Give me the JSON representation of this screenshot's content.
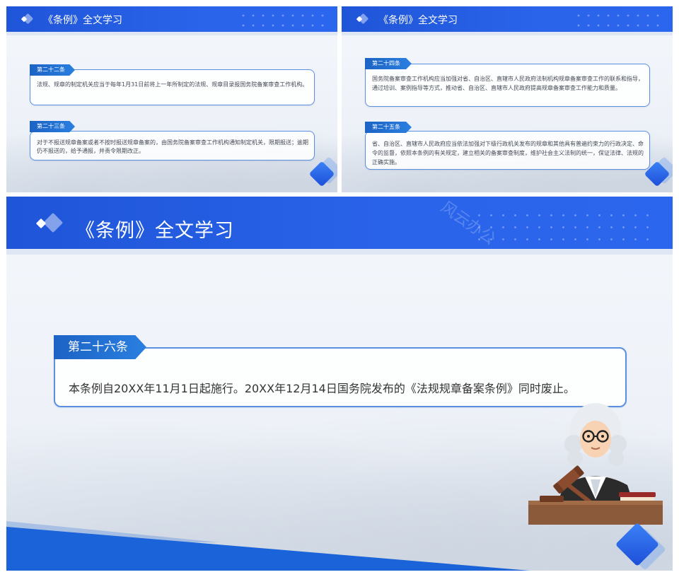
{
  "slides": [
    {
      "title": "《条例》全文学习",
      "articles": [
        {
          "tag": "第二十二条",
          "text": "法规、规章的制定机关应当于每年1月31日前将上一年所制定的法规、规章目录报国务院备案审查工作机构。"
        },
        {
          "tag": "第二十三条",
          "text": "对于不报送规章备案或者不按时报送规章备案的，由国务院备案审查工作机构通知制定机关，限期报送；逾期仍不报送的，给予通报，并责令限期改正。"
        }
      ]
    },
    {
      "title": "《条例》全文学习",
      "articles": [
        {
          "tag": "第二十四条",
          "text": "国务院备案审查工作机构应当加强对省、自治区、直辖市人民政府法制机构规章备案审查工作的联系和指导，通过培训、案例指导等方式，推动省、自治区、直辖市人民政府提高规章备案审查工作能力和质量。"
        },
        {
          "tag": "第二十五条",
          "text": "省、自治区、直辖市人民政府应当依法加强对下级行政机关发布的规章和其他具有普遍约束力的行政决定、命令的监督，依照本条例的有关规定，建立相关的备案审查制度，维护社会主义法制的统一，保证法律、法规的正确实施。"
        }
      ]
    },
    {
      "title": "《条例》全文学习",
      "watermark": "风云办公",
      "articles": [
        {
          "tag": "第二十六条",
          "text": "本条例自20XX年11月1日起施行。20XX年12月14日国务院发布的《法规规章备案条例》同时废止。"
        }
      ]
    }
  ],
  "colors": {
    "header_blue": "#2a64ea",
    "tag_blue": "#1c63c4",
    "border_blue": "#5b8fdf"
  }
}
